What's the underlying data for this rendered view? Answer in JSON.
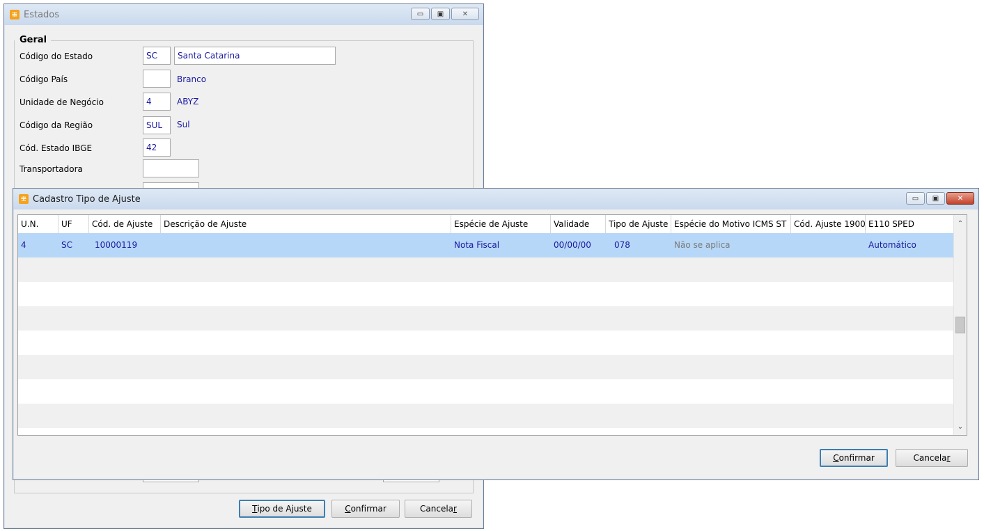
{
  "estados_window": {
    "title": "Estados",
    "group_label": "Geral",
    "fields": [
      {
        "label": "Código do Estado",
        "code": "SC",
        "desc": "Santa Catarina"
      },
      {
        "label": "Código País",
        "code": "",
        "desc": "Branco"
      },
      {
        "label": "Unidade de Negócio",
        "code": "4",
        "desc": "ABYZ"
      },
      {
        "label": "Código da Região",
        "code": "SUL",
        "desc": "Sul"
      },
      {
        "label": "Cód. Estado IBGE",
        "code": "42",
        "desc": ""
      },
      {
        "label": "Transportadora",
        "code": "",
        "desc": ""
      }
    ],
    "buttons": {
      "tipo_prefix": "T",
      "tipo_rest": "ipo de Ajuste",
      "confirmar_prefix": "C",
      "confirmar_rest": "onfirmar",
      "cancelar_main": "Cancela",
      "cancelar_suffix": "r"
    }
  },
  "cadastro_window": {
    "title": "Cadastro Tipo de Ajuste",
    "columns": [
      "U.N.",
      "UF",
      "Cód. de Ajuste",
      "Descrição de Ajuste",
      "Espécie de Ajuste",
      "Validade",
      "Tipo de Ajuste",
      "Espécie do Motivo ICMS ST",
      "Cód. Ajuste 1900",
      "E110 SPED"
    ],
    "rows": [
      {
        "un": "4",
        "uf": "SC",
        "cod_ajuste": "10000119",
        "descricao": "",
        "especie": "Nota Fiscal",
        "validade": "00/00/00",
        "tipo": "078",
        "especie_motivo": "Não se aplica",
        "cod_1900": "",
        "e110": "Automático"
      }
    ],
    "buttons": {
      "confirmar_prefix": "C",
      "confirmar_rest": "onfirmar",
      "cancelar_main": "Cancela",
      "cancelar_suffix": "r"
    }
  },
  "icons": {
    "app": "app-logo-icon",
    "minimize": "minimize-icon",
    "maximize": "maximize-icon",
    "close": "close-icon",
    "scroll_up": "chevron-up-icon",
    "scroll_down": "chevron-down-icon"
  },
  "colors": {
    "title_bar": "#c9d9ed",
    "selected_row": "#b6d7f7",
    "value_text": "#1a1aa0",
    "close_button": "#c3412a"
  }
}
